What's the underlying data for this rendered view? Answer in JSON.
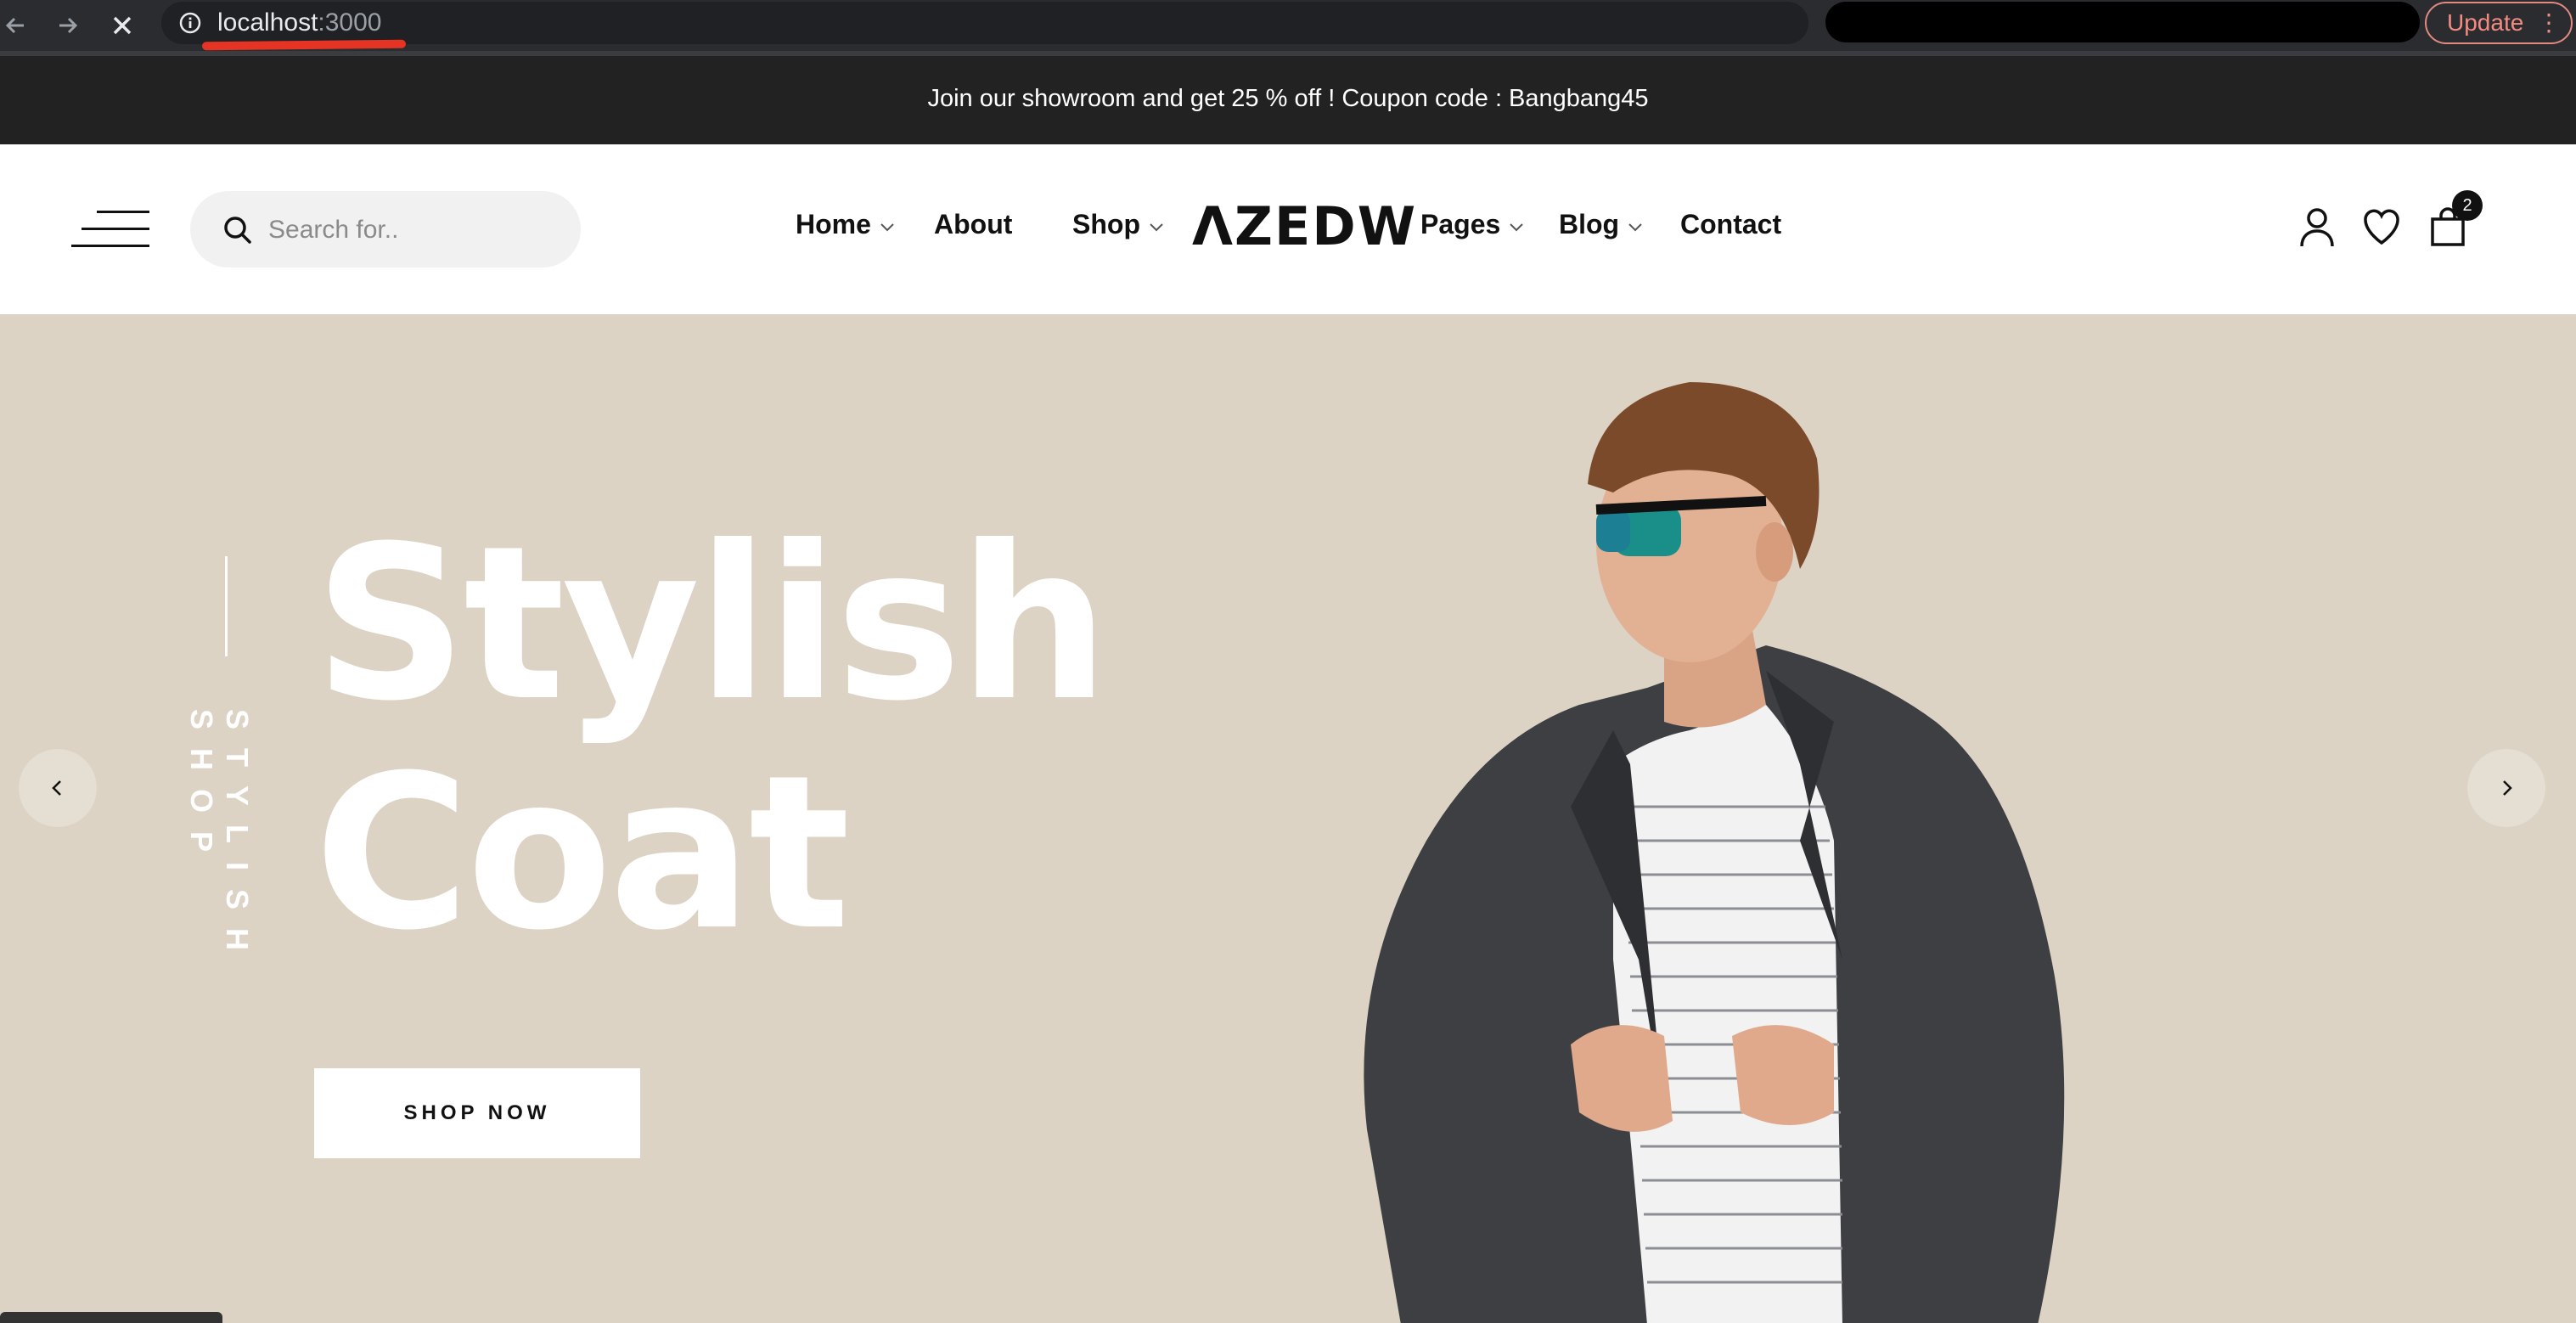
{
  "browser": {
    "url_host": "localhost",
    "url_port": ":3000",
    "update_label": "Update",
    "kebab": "⋮"
  },
  "announcement": "Join our showroom and get 25 % off ! Coupon code : Bangbang45",
  "header": {
    "search_placeholder": "Search for..",
    "nav": {
      "home": "Home",
      "about": "About",
      "shop": "Shop",
      "pages": "Pages",
      "blog": "Blog",
      "contact": "Contact"
    },
    "logo": "ΛZEDW",
    "cart_count": "2"
  },
  "hero": {
    "title_line1": "Stylish",
    "title_line2": "Coat",
    "vertical_label": "STYLISH SHOP",
    "cta": "SHOP NOW"
  },
  "colors": {
    "announcement_bg": "#222222",
    "hero_bg": "#dcd3c5",
    "accent_underline": "#e53423"
  }
}
